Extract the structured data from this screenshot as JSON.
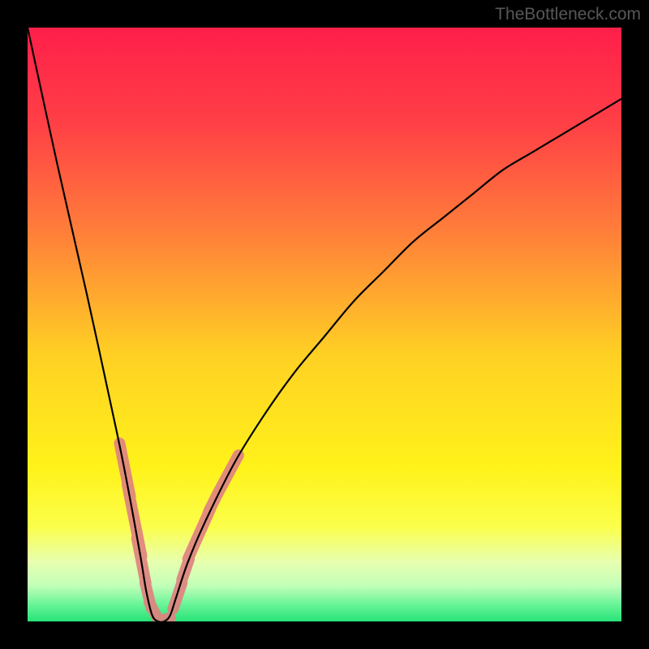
{
  "watermark": {
    "text": "TheBottleneck.com"
  },
  "chart_data": {
    "type": "line",
    "title": "",
    "xlabel": "",
    "ylabel": "",
    "xlim": [
      0,
      100
    ],
    "ylim": [
      0,
      100
    ],
    "series": [
      {
        "name": "bottleneck-curve",
        "x": [
          0,
          5,
          10,
          15,
          17,
          19,
          20,
          21,
          22,
          23,
          24,
          25,
          27,
          30,
          35,
          40,
          45,
          50,
          55,
          60,
          65,
          70,
          75,
          80,
          85,
          90,
          95,
          100
        ],
        "y": [
          100,
          77,
          55,
          32,
          22,
          11,
          5,
          1,
          0,
          0,
          1,
          4,
          10,
          17,
          27,
          35,
          42,
          48,
          54,
          59,
          64,
          68,
          72,
          76,
          79,
          82,
          85,
          88
        ]
      },
      {
        "name": "highlight-segments",
        "segments": [
          {
            "x": [
              15.5,
              17.3
            ],
            "y": [
              30,
              21
            ]
          },
          {
            "x": [
              16.8,
              19.2
            ],
            "y": [
              23,
              11
            ]
          },
          {
            "x": [
              18.4,
              19.9
            ],
            "y": [
              14,
              6.5
            ]
          },
          {
            "x": [
              19.8,
              20.8
            ],
            "y": [
              6.5,
              2.3
            ]
          },
          {
            "x": [
              20.5,
              22.0
            ],
            "y": [
              3.2,
              0.3
            ]
          },
          {
            "x": [
              22.0,
              24.0
            ],
            "y": [
              0.1,
              0.6
            ]
          },
          {
            "x": [
              24.5,
              26.0
            ],
            "y": [
              2.1,
              6.5
            ]
          },
          {
            "x": [
              26.0,
              27.2
            ],
            "y": [
              7.0,
              10.5
            ]
          },
          {
            "x": [
              27.0,
              30.8
            ],
            "y": [
              10.5,
              19.0
            ]
          },
          {
            "x": [
              30.5,
              32.0
            ],
            "y": [
              18.5,
              21.5
            ]
          },
          {
            "x": [
              32.0,
              35.5
            ],
            "y": [
              21.5,
              28.0
            ]
          }
        ]
      }
    ],
    "gradient_stops": [
      {
        "pos": 0.0,
        "color": "#ff1f4a"
      },
      {
        "pos": 0.16,
        "color": "#ff3f46"
      },
      {
        "pos": 0.34,
        "color": "#ff7d3a"
      },
      {
        "pos": 0.55,
        "color": "#ffd024"
      },
      {
        "pos": 0.74,
        "color": "#fff21a"
      },
      {
        "pos": 0.84,
        "color": "#fbff4a"
      },
      {
        "pos": 0.9,
        "color": "#e7ffb0"
      },
      {
        "pos": 0.94,
        "color": "#c2ffb8"
      },
      {
        "pos": 0.97,
        "color": "#6cf59a"
      },
      {
        "pos": 1.0,
        "color": "#27e378"
      }
    ]
  }
}
